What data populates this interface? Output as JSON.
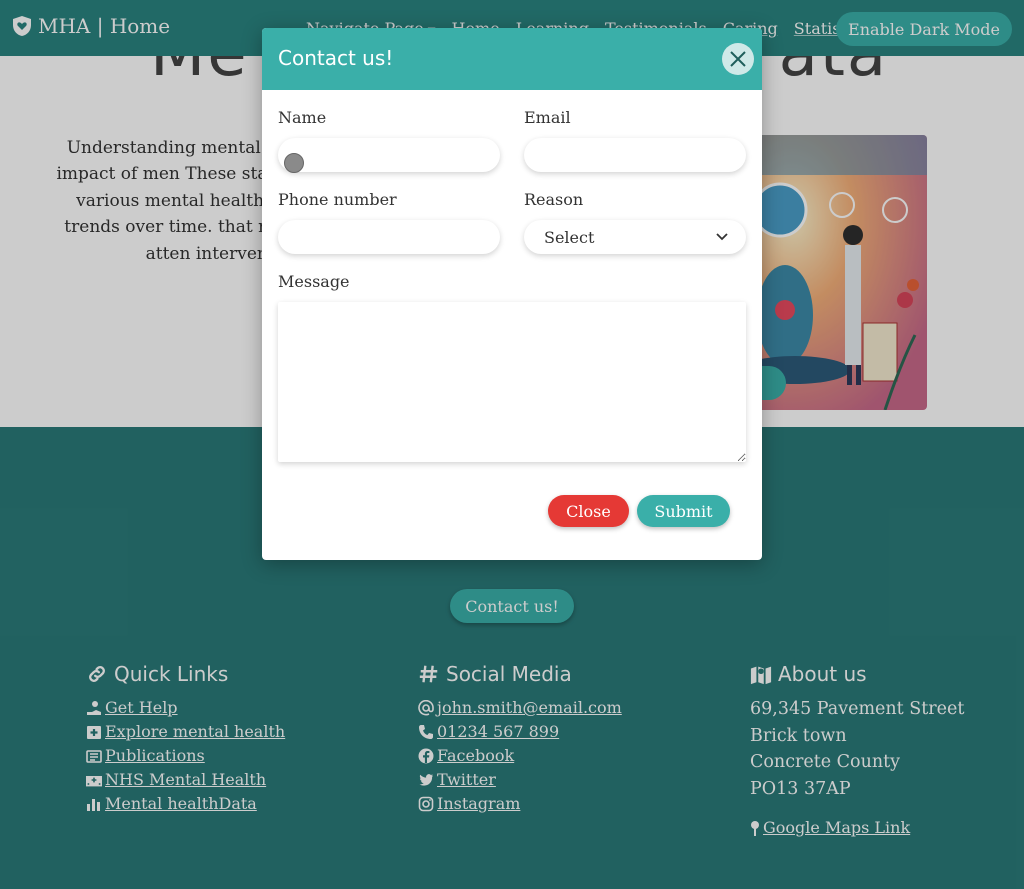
{
  "navbar": {
    "brand": "MHA | Home",
    "links": [
      "Navigate Page",
      "Home",
      "Learning",
      "Testimonials",
      "Caring",
      "Statistics"
    ],
    "dark_mode_button": "Enable Dark Mode"
  },
  "hero": {
    "heading_left": "Me",
    "heading_right": "ata",
    "paragraph": "Understanding mental h scope and impact of men These statistics provid various mental health co and the trends over time. that require more atten interventio"
  },
  "contact_button": "Contact us!",
  "modal": {
    "title": "Contact us!",
    "labels": {
      "name": "Name",
      "email": "Email",
      "phone": "Phone number",
      "reason": "Reason",
      "message": "Message"
    },
    "reason_selected": "Select",
    "close_button": "Close",
    "submit_button": "Submit"
  },
  "footer": {
    "quick_links": {
      "title": "Quick Links",
      "items": [
        {
          "icon": "hand-heart-icon",
          "label": "Get Help"
        },
        {
          "icon": "medical-kit-icon",
          "label": "Explore mental health"
        },
        {
          "icon": "newspaper-icon",
          "label": "Publications"
        },
        {
          "icon": "hospital-icon",
          "label": "NHS Mental Health"
        },
        {
          "icon": "bar-chart-icon",
          "label": "Mental healthData"
        }
      ]
    },
    "social_media": {
      "title": "Social Media",
      "items": [
        {
          "icon": "at-icon",
          "label": "john.smith@email.com"
        },
        {
          "icon": "phone-icon",
          "label": "01234 567 899"
        },
        {
          "icon": "facebook-icon",
          "label": "Facebook"
        },
        {
          "icon": "twitter-icon",
          "label": "Twitter"
        },
        {
          "icon": "instagram-icon",
          "label": "Instagram"
        }
      ]
    },
    "about_us": {
      "title": "About us",
      "address": [
        "69,345 Pavement Street",
        "Brick town",
        "Concrete County",
        "PO13 37AP"
      ],
      "maps_link": "Google Maps Link"
    }
  },
  "colors": {
    "teal_primary": "#3aafa9",
    "teal_dark": "#2a7a79",
    "danger": "#e53935"
  }
}
